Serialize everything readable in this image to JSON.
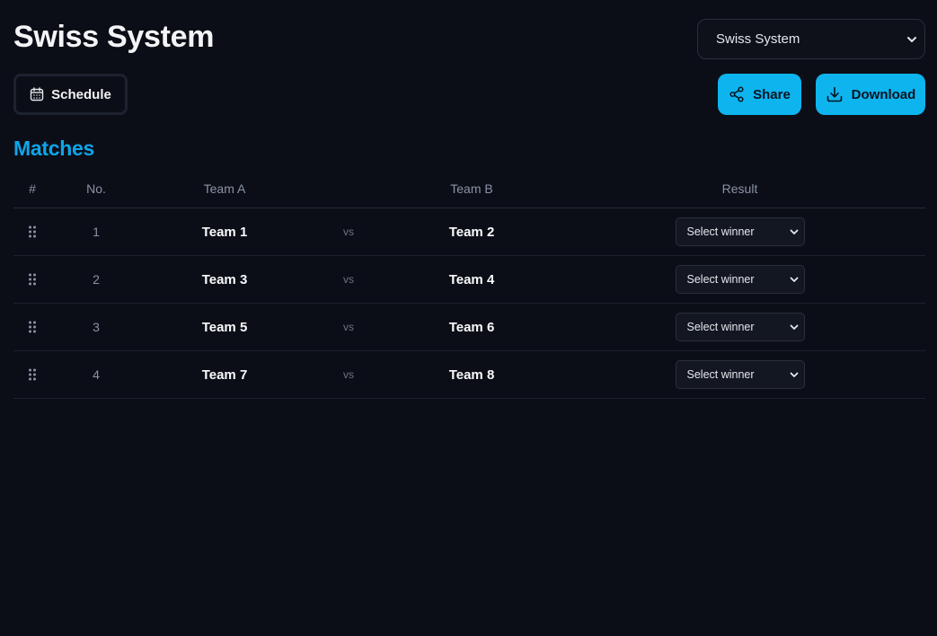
{
  "header": {
    "title": "Swiss System",
    "format_select_value": "Swiss System"
  },
  "toolbar": {
    "schedule_label": "Schedule",
    "share_label": "Share",
    "download_label": "Download"
  },
  "section": {
    "title": "Matches"
  },
  "table": {
    "columns": {
      "hash": "#",
      "no": "No.",
      "team_a": "Team A",
      "team_b": "Team B",
      "result": "Result"
    },
    "rows": [
      {
        "no": "1",
        "team_a": "Team 1",
        "vs": "vs",
        "team_b": "Team 2",
        "result": "Select winner"
      },
      {
        "no": "2",
        "team_a": "Team 3",
        "vs": "vs",
        "team_b": "Team 4",
        "result": "Select winner"
      },
      {
        "no": "3",
        "team_a": "Team 5",
        "vs": "vs",
        "team_b": "Team 6",
        "result": "Select winner"
      },
      {
        "no": "4",
        "team_a": "Team 7",
        "vs": "vs",
        "team_b": "Team 8",
        "result": "Select winner"
      }
    ]
  },
  "icons": {
    "schedule": "calendar-icon",
    "share": "share-icon",
    "download": "download-icon",
    "row_handle": "drag-handle-icon",
    "dropdown": "chevron-down-icon"
  },
  "colors": {
    "background": "#0c0e17",
    "accent": "#0db4ee",
    "section_title": "#0ea5e9",
    "muted_text": "#8a93a6"
  }
}
